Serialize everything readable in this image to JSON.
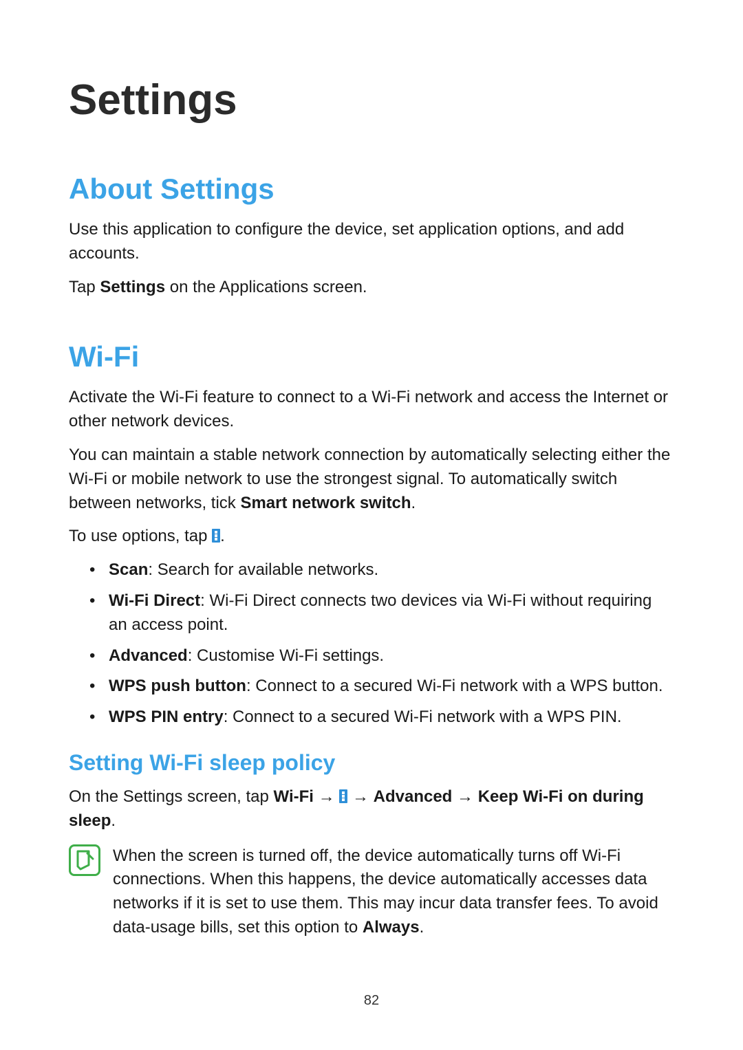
{
  "page_number": "82",
  "title": "Settings",
  "sections": {
    "about": {
      "heading": "About Settings",
      "p1": "Use this application to configure the device, set application options, and add accounts.",
      "p2_pre": "Tap ",
      "p2_bold": "Settings",
      "p2_post": " on the Applications screen."
    },
    "wifi": {
      "heading": "Wi-Fi",
      "p1": "Activate the Wi-Fi feature to connect to a Wi-Fi network and access the Internet or other network devices.",
      "p2_pre": "You can maintain a stable network connection by automatically selecting either the Wi-Fi or mobile network to use the strongest signal. To automatically switch between networks, tick ",
      "p2_bold": "Smart network switch",
      "p2_post": ".",
      "p3_pre": "To use options, tap ",
      "p3_post": ".",
      "options": [
        {
          "label": "Scan",
          "desc": ": Search for available networks."
        },
        {
          "label": "Wi-Fi Direct",
          "desc": ": Wi-Fi Direct connects two devices via Wi-Fi without requiring an access point."
        },
        {
          "label": "Advanced",
          "desc": ": Customise Wi-Fi settings."
        },
        {
          "label": "WPS push button",
          "desc": ": Connect to a secured Wi-Fi network with a WPS button."
        },
        {
          "label": "WPS PIN entry",
          "desc": ": Connect to a secured Wi-Fi network with a WPS PIN."
        }
      ],
      "sleep": {
        "heading": "Setting Wi-Fi sleep policy",
        "nav_pre": "On the Settings screen, tap ",
        "nav_wifi": "Wi-Fi",
        "arrow": " → ",
        "nav_advanced": "Advanced",
        "nav_keep": "Keep Wi-Fi on during sleep",
        "nav_post": ".",
        "note_pre": "When the screen is turned off, the device automatically turns off Wi-Fi connections. When this happens, the device automatically accesses data networks if it is set to use them. This may incur data transfer fees. To avoid data-usage bills, set this option to ",
        "note_bold": "Always",
        "note_post": "."
      }
    }
  }
}
